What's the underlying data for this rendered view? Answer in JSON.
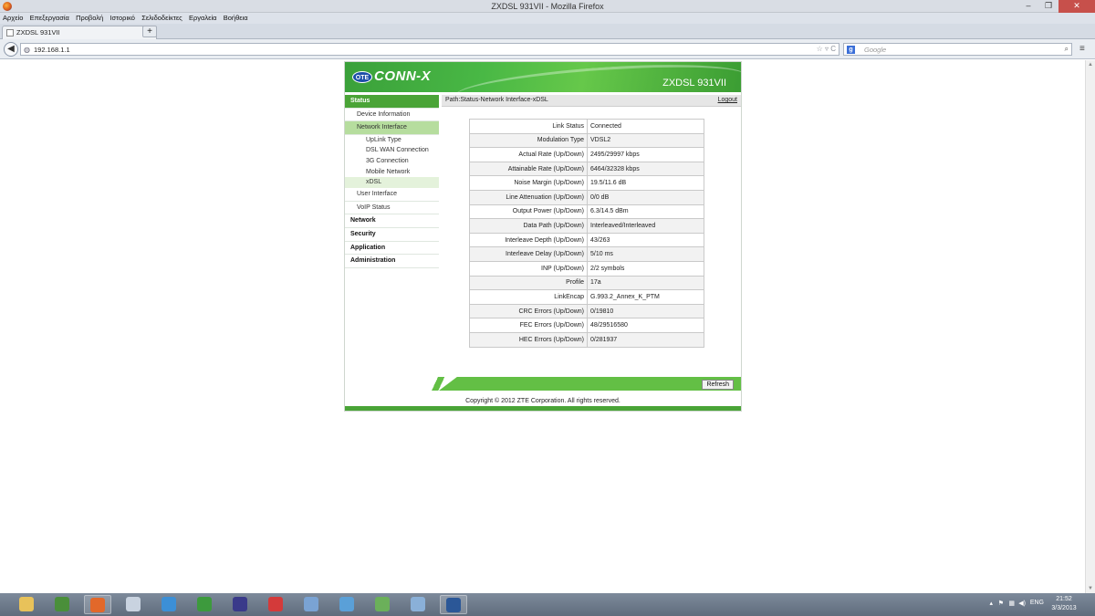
{
  "window": {
    "title": "ZXDSL 931VII - Mozilla Firefox",
    "min_glyph": "–",
    "max_glyph": "❐",
    "close_glyph": "✕"
  },
  "menubar": [
    "Αρχείο",
    "Επεξεργασία",
    "Προβολή",
    "Ιστορικό",
    "Σελιδοδείκτες",
    "Εργαλεία",
    "Βοήθεια"
  ],
  "tab": {
    "label": "ZXDSL 931VII",
    "close_glyph": "×",
    "new_tab_glyph": "+"
  },
  "nav": {
    "url": "192.168.1.1",
    "search_placeholder": "Google",
    "back_glyph": "◀",
    "url_icons": "☆ ▿ C",
    "search_glyph": "⌕",
    "menu_glyph": "≡"
  },
  "router": {
    "logo_ote": "OTE",
    "logo_brand": "CONN-X",
    "model": "ZXDSL 931VII",
    "path": "Path:Status-Network Interface-xDSL",
    "logout": "Logout",
    "refresh_label": "Refresh",
    "copyright": "Copyright © 2012 ZTE Corporation. All rights reserved.",
    "sidebar": [
      {
        "label": "Status",
        "level": "head",
        "active": true
      },
      {
        "label": "Device Information",
        "level": "l1",
        "active": false
      },
      {
        "label": "Network Interface",
        "level": "l1",
        "active": true
      },
      {
        "label": "UpLink Type",
        "level": "l2",
        "active": false
      },
      {
        "label": "DSL WAN Connection",
        "level": "l2",
        "active": false
      },
      {
        "label": "3G Connection",
        "level": "l2",
        "active": false
      },
      {
        "label": "Mobile Network",
        "level": "l2",
        "active": false
      },
      {
        "label": "xDSL",
        "level": "l2",
        "active": true
      },
      {
        "label": "User Interface",
        "level": "l1",
        "active": false
      },
      {
        "label": "VoIP Status",
        "level": "l1",
        "active": false
      },
      {
        "label": "Network",
        "level": "head",
        "active": false
      },
      {
        "label": "Security",
        "level": "head",
        "active": false
      },
      {
        "label": "Application",
        "level": "head",
        "active": false
      },
      {
        "label": "Administration",
        "level": "head",
        "active": false
      }
    ],
    "stats": [
      {
        "key": "Link Status",
        "value": "Connected"
      },
      {
        "key": "Modulation Type",
        "value": "VDSL2"
      },
      {
        "key": "Actual Rate (Up/Down)",
        "value": "2495/29997 kbps"
      },
      {
        "key": "Attainable Rate (Up/Down)",
        "value": "6464/32328 kbps"
      },
      {
        "key": "Noise Margin (Up/Down)",
        "value": "19.5/11.6 dB"
      },
      {
        "key": "Line Attenuation (Up/Down)",
        "value": "0/0 dB"
      },
      {
        "key": "Output Power (Up/Down)",
        "value": "6.3/14.5 dBm"
      },
      {
        "key": "Data Path (Up/Down)",
        "value": "Interleaved/Interleaved"
      },
      {
        "key": "Interleave Depth (Up/Down)",
        "value": "43/263"
      },
      {
        "key": "Interleave Delay (Up/Down)",
        "value": "5/10 ms"
      },
      {
        "key": "INP (Up/Down)",
        "value": "2/2 symbols"
      },
      {
        "key": "Profile",
        "value": "17a"
      },
      {
        "key": "LinkEncap",
        "value": "G.993.2_Annex_K_PTM"
      },
      {
        "key": "CRC Errors (Up/Down)",
        "value": "0/19810"
      },
      {
        "key": "FEC Errors (Up/Down)",
        "value": "48/29516580"
      },
      {
        "key": "HEC Errors (Up/Down)",
        "value": "0/281937"
      }
    ]
  },
  "taskbar": {
    "apps": [
      {
        "name": "file-explorer",
        "color": "#e8c25a",
        "active": false
      },
      {
        "name": "chrome",
        "color": "#4a8f3a",
        "active": false
      },
      {
        "name": "firefox",
        "color": "#e2682a",
        "active": true
      },
      {
        "name": "notepad",
        "color": "#c9d3e0",
        "active": false
      },
      {
        "name": "internet-explorer",
        "color": "#3c8fd6",
        "active": false
      },
      {
        "name": "utorrent",
        "color": "#3d9a3d",
        "active": false
      },
      {
        "name": "media-player",
        "color": "#3a3a8a",
        "active": false
      },
      {
        "name": "download-manager",
        "color": "#d43a3a",
        "active": false
      },
      {
        "name": "paint",
        "color": "#7aa3d4",
        "active": false
      },
      {
        "name": "network-globe",
        "color": "#5aa0d8",
        "active": false
      },
      {
        "name": "users",
        "color": "#6bb05a",
        "active": false
      },
      {
        "name": "remote-desktop",
        "color": "#8ab0d8",
        "active": false
      },
      {
        "name": "word",
        "color": "#2b5797",
        "active": true
      }
    ],
    "tray_language": "ENG",
    "time": "21:52",
    "date": "3/3/2013"
  }
}
